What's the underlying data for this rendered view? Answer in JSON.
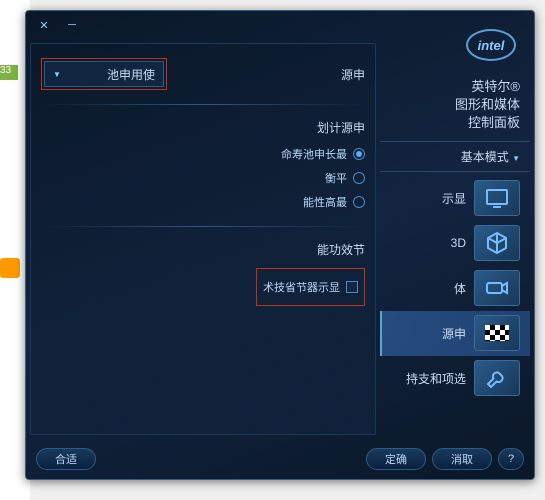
{
  "logo": "intel",
  "brand": {
    "line1": "英特尔®",
    "line2": "图形和媒体",
    "line3": "控制面板"
  },
  "modes_label": "基本模式",
  "nav": [
    {
      "label": "示显",
      "icon": "display"
    },
    {
      "label": "3D",
      "icon": "cube"
    },
    {
      "label": "体",
      "icon": "camera"
    },
    {
      "label": "源申",
      "icon": "flag"
    },
    {
      "label": "持支和项选",
      "icon": "wrench"
    }
  ],
  "active_nav": 3,
  "main": {
    "section1_label": "源申",
    "dropdown_value": "池申用使",
    "plan_label": "划计源申",
    "radios": [
      {
        "label": "命寿池申长最",
        "selected": true
      },
      {
        "label": "衡平",
        "selected": false
      },
      {
        "label": "能性高最",
        "selected": false
      }
    ],
    "section2_label": "能功效节",
    "checkbox_label": "术技省节器示显"
  },
  "footer": {
    "help": "?",
    "b1": "定确",
    "b2": "消取",
    "b3": "合适"
  }
}
